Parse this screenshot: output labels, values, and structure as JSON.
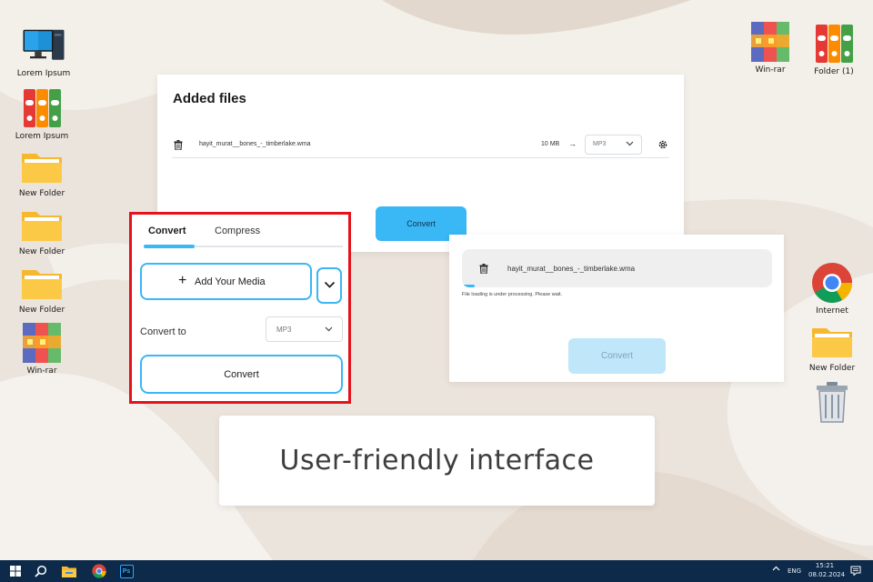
{
  "desktop": {
    "icons_left": [
      {
        "label": "Lorem Ipsum",
        "icon": "computer-icon"
      },
      {
        "label": "Lorem Ipsum",
        "icon": "binders-icon"
      },
      {
        "label": "New Folder",
        "icon": "folder-icon"
      },
      {
        "label": "New Folder",
        "icon": "folder-icon"
      },
      {
        "label": "New Folder",
        "icon": "folder-icon"
      },
      {
        "label": "Win-rar",
        "icon": "winrar-icon"
      }
    ],
    "icons_right": [
      {
        "label": "Win-rar",
        "icon": "winrar-icon"
      },
      {
        "label": "Folder (1)",
        "icon": "binders-icon"
      },
      {
        "label": "Internet",
        "icon": "chrome-icon"
      },
      {
        "label": "New Folder",
        "icon": "folder-icon"
      },
      {
        "label": "",
        "icon": "recycle-bin-icon"
      }
    ]
  },
  "added_files": {
    "title": "Added files",
    "file_name": "hayit_murat__bones_-_timberlake.wma",
    "file_size": "10 MB",
    "arrow": "→",
    "format": "MP3",
    "convert_label": "Convert"
  },
  "converter": {
    "tabs": [
      {
        "label": "Convert",
        "active": true
      },
      {
        "label": "Compress",
        "active": false
      }
    ],
    "add_media_label": "Add Your Media",
    "convert_to_label": "Convert to",
    "format": "MP3",
    "convert_label": "Convert"
  },
  "processing": {
    "file_name": "hayit_murat__bones_-_timberlake.wma",
    "progress": 0.04,
    "note": "File loading is under processing. Please wait.",
    "convert_label": "Convert"
  },
  "caption": {
    "text": "User-friendly interface"
  },
  "taskbar": {
    "apps": [
      "windows-start-icon",
      "search-icon",
      "file-explorer-icon",
      "chrome-icon",
      "photoshop-icon"
    ],
    "photoshop_label": "Ps",
    "language": "ENG",
    "time": "15:21",
    "date": "08.02.2024"
  },
  "colors": {
    "accent": "#3ab7f5",
    "highlight_border": "#e4121b",
    "taskbar": "#0e2a4a"
  }
}
